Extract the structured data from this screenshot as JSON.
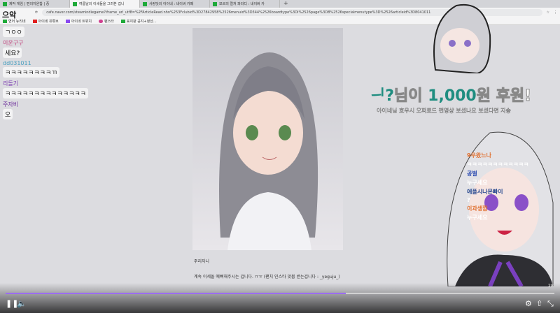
{
  "stream": {
    "title": "으악"
  },
  "browser": {
    "tabs": [
      {
        "label": "제작 게임 | 편의지원함 | 중"
      },
      {
        "label": "여름날의 이세돌을 그려본 겁니"
      },
      {
        "label": "사랑닷의 아이네 : 네이버 카페"
      },
      {
        "label": "모르의 컬처 파라디 : 네이버 카"
      }
    ],
    "url": "cafe.naver.com/steamindiegame?iframe_url_utf8=%2FArticleRead.nhn%253Fclubid%3D27842958%2526menuid%3D344%2526boardtype%3DI%2526page%3D8%2526specialmenutype%3D%2526articleid%3D8041011",
    "bookmarks": [
      "연어 뉴리네",
      "아이네 유튜브",
      "아이네 트위치",
      "팬스타",
      "표지왕 공지+정산..."
    ]
  },
  "chat": [
    {
      "user": "",
      "text": "ㄱㅇㅇ",
      "color": "#333"
    },
    {
      "user": "이운구구",
      "text": "세요?",
      "color": "#c0407a"
    },
    {
      "user": "dd031011",
      "text": "ㅋㅋㅋㅋㅋㅋㅋㅋㄲ",
      "color": "#4aa0c0"
    },
    {
      "user": "리돌기",
      "text": "ㅋㅋㅋㅋㅋㅋㅋㅋㅋㅋㅋㅋㅋㅋ",
      "color": "#7a3ab0"
    },
    {
      "user": "주자비",
      "text": "오",
      "color": "#6a2a9a"
    }
  ],
  "post": {
    "author": "주리자니",
    "text": "계속 이세돌 예뻐해주시는 겁니다. ㅠㅠ (팬치 인스타 맛봅 받는겁니다 : _yeguju_)"
  },
  "donation": {
    "name": "ᅴ?",
    "mid": "님이 ",
    "amount": "1,000",
    "unit": "원 후원!",
    "message": "아이네님 호우시 오퍼로드 편영상 보셨나요 보셨다면 지송"
  },
  "right_chat": [
    {
      "user": "9우왔느나",
      "text": "ㅋㅋㅋㅋㅋㅋㅋㅋㅋㅋㅋㅋ",
      "color": "#e07030"
    },
    {
      "user": "공벌",
      "text": "누구세요",
      "color": "#2a4ab0"
    },
    {
      "user": "애플시나몬빠이",
      "text": "?",
      "color": "#2a4a90"
    },
    {
      "user": "이과생깜",
      "text": "누구세요",
      "color": "#e07030"
    }
  ],
  "player": {
    "progress": 0.62,
    "time": "28"
  },
  "colors": {
    "accent": "#9b6cf0",
    "donation": "#1f8d80"
  }
}
